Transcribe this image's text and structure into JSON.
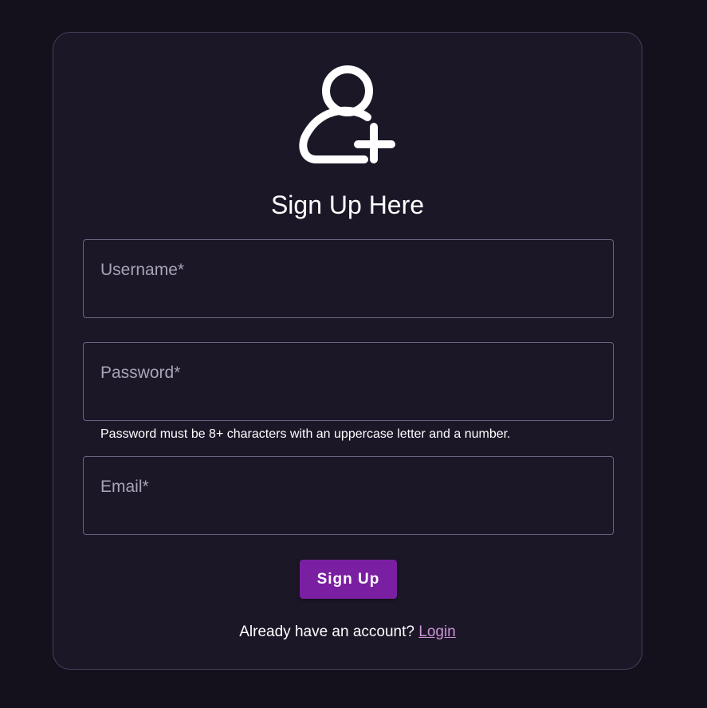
{
  "header": {
    "icon": "person-add-icon",
    "title": "Sign Up Here"
  },
  "form": {
    "username": {
      "label": "Username*",
      "value": ""
    },
    "password": {
      "label": "Password*",
      "value": "",
      "helper": "Password must be 8+ characters with an uppercase letter and a number."
    },
    "email": {
      "label": "Email*",
      "value": ""
    },
    "submit_label": "Sign Up"
  },
  "footer": {
    "prompt": "Already have an account?",
    "link_label": "Login"
  },
  "colors": {
    "page_background": "#14111d",
    "card_background": "#1b1727",
    "button": "#7b1fa2",
    "link": "#ce93d8"
  }
}
